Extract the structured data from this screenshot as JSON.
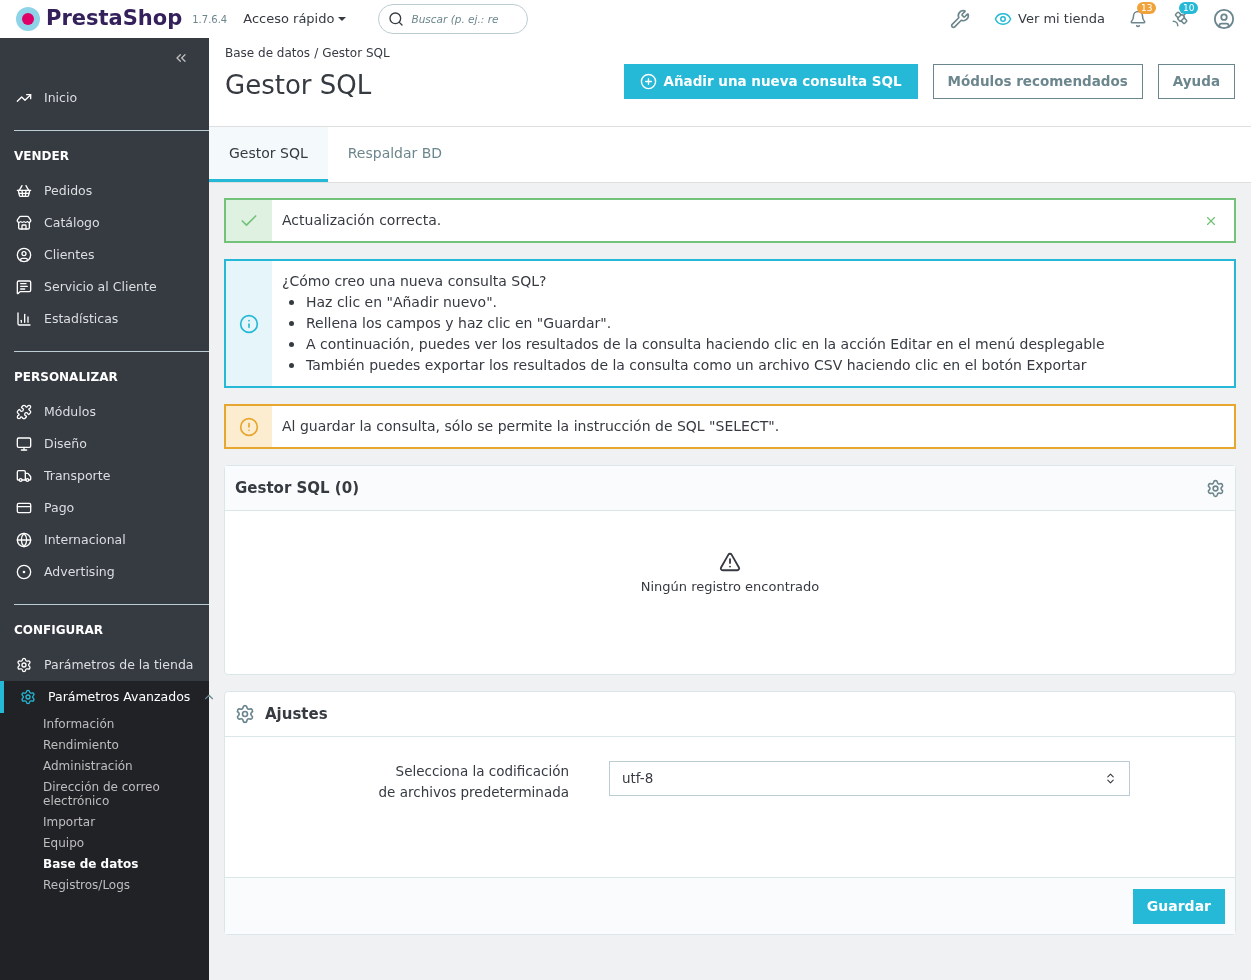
{
  "header": {
    "brand": "PrestaShop",
    "version": "1.7.6.4",
    "quick_access": "Acceso rápido",
    "search": {
      "placeholder": "Buscar (p. ej.: re"
    },
    "view_store": "Ver mi tienda",
    "notifications": [
      {
        "count": "13",
        "color": "#f0a33a"
      },
      {
        "count": "10",
        "color": "#25b9d7"
      }
    ]
  },
  "sidebar": {
    "top_items": [
      {
        "label": "Inicio",
        "selected": false
      }
    ],
    "sections": [
      {
        "title": "VENDER",
        "items": [
          {
            "label": "Pedidos",
            "selected": false
          },
          {
            "label": "Catálogo",
            "selected": false
          },
          {
            "label": "Clientes",
            "selected": false
          },
          {
            "label": "Servicio al Cliente",
            "selected": false
          },
          {
            "label": "Estadísticas",
            "selected": false
          }
        ]
      },
      {
        "title": "PERSONALIZAR",
        "items": [
          {
            "label": "Módulos",
            "selected": false
          },
          {
            "label": "Diseño",
            "selected": false
          },
          {
            "label": "Transporte",
            "selected": false
          },
          {
            "label": "Pago",
            "selected": false
          },
          {
            "label": "Internacional",
            "selected": false
          },
          {
            "label": "Advertising",
            "selected": false
          }
        ]
      },
      {
        "title": "CONFIGURAR",
        "items": [
          {
            "label": "Parámetros de la tienda",
            "selected": false
          },
          {
            "label": "Parámetros Avanzados",
            "selected": true,
            "expanded": true,
            "children": [
              {
                "label": "Información",
                "selected": false
              },
              {
                "label": "Rendimiento",
                "selected": false
              },
              {
                "label": "Administración",
                "selected": false
              },
              {
                "label": "Dirección de correo electrónico",
                "selected": false
              },
              {
                "label": "Importar",
                "selected": false
              },
              {
                "label": "Equipo",
                "selected": false
              },
              {
                "label": "Base de datos",
                "selected": true
              },
              {
                "label": "Registros/Logs",
                "selected": false
              }
            ]
          }
        ]
      }
    ]
  },
  "breadcrumb": {
    "items": [
      "Base de datos",
      "Gestor SQL"
    ],
    "separator": "/"
  },
  "page_title": "Gestor SQL",
  "toolbar_buttons": [
    {
      "label": "Añadir una nueva consulta SQL",
      "kind": "primary"
    },
    {
      "label": "Módulos recomendados",
      "kind": "outline"
    },
    {
      "label": "Ayuda",
      "kind": "outline"
    }
  ],
  "tabs": [
    {
      "label": "Gestor SQL",
      "selected": true
    },
    {
      "label": "Respaldar BD",
      "selected": false
    }
  ],
  "alerts": [
    {
      "kind": "success",
      "text": "Actualización correcta."
    },
    {
      "kind": "info",
      "title": "¿Cómo creo una nueva consulta SQL?",
      "bullets": [
        "Haz clic en \"Añadir nuevo\".",
        "Rellena los campos y haz clic en \"Guardar\".",
        "A continuación, puedes ver los resultados de la consulta haciendo clic en la acción Editar en el menú desplegable",
        "También puedes exportar los resultados de la consulta como un archivo CSV haciendo clic en el botón Exportar"
      ]
    },
    {
      "kind": "warning",
      "text": "Al guardar la consulta, sólo se permite la instrucción de SQL \"SELECT\"."
    }
  ],
  "list_panel": {
    "title": "Gestor SQL (0)",
    "empty_message": "Ningún registro encontrado"
  },
  "settings_panel": {
    "title": "Ajustes",
    "field_label": "Selecciona la codificación de archivos predeterminada",
    "field_value": "utf-8",
    "save": "Guardar"
  }
}
